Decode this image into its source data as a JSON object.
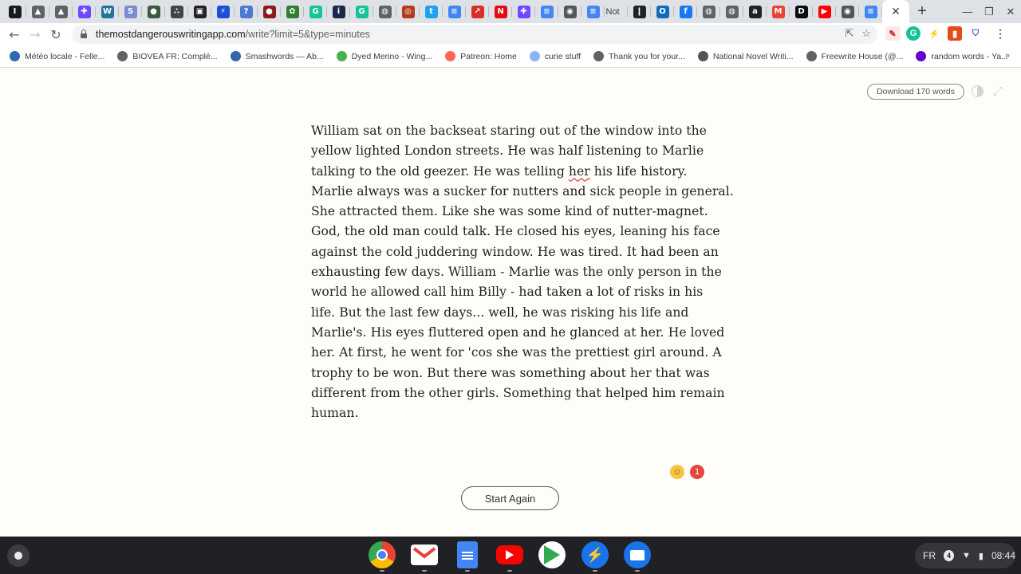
{
  "tabs": {
    "favicons": [
      {
        "name": "instapaper-icon",
        "glyph": "I",
        "bg": "#1a1a1a"
      },
      {
        "name": "mountain-icon",
        "glyph": "▲",
        "bg": "#5f6368"
      },
      {
        "name": "mountain-icon-2",
        "glyph": "▲",
        "bg": "#5f6368"
      },
      {
        "name": "slack-icon",
        "glyph": "✚",
        "bg": "#6d4aff"
      },
      {
        "name": "wordpress-icon",
        "glyph": "W",
        "bg": "#21759b"
      },
      {
        "name": "scrivener-icon",
        "glyph": "S",
        "bg": "#7b8bd4"
      },
      {
        "name": "wheel-icon",
        "glyph": "●",
        "bg": "#3a5a40"
      },
      {
        "name": "dots-icon",
        "glyph": "∴",
        "bg": "#444"
      },
      {
        "name": "tv-icon",
        "glyph": "▣",
        "bg": "#222"
      },
      {
        "name": "bolt-icon",
        "glyph": "⚡",
        "bg": "#1d4ed8"
      },
      {
        "name": "help-icon",
        "glyph": "?",
        "bg": "#4a7bd0"
      },
      {
        "name": "circle-icon",
        "glyph": "●",
        "bg": "#8b1a1a"
      },
      {
        "name": "leaf-icon",
        "glyph": "✿",
        "bg": "#2e7d32"
      },
      {
        "name": "grammarly-icon",
        "glyph": "G",
        "bg": "#15c39a"
      },
      {
        "name": "info-icon",
        "glyph": "i",
        "bg": "#1a2a4a"
      },
      {
        "name": "grammarly-icon-2",
        "glyph": "G",
        "bg": "#15c39a"
      },
      {
        "name": "globe-icon",
        "glyph": "◍",
        "bg": "#5f6368"
      },
      {
        "name": "target-icon",
        "glyph": "◎",
        "bg": "#b23b1f"
      },
      {
        "name": "twitter-icon",
        "glyph": "t",
        "bg": "#1da1f2"
      },
      {
        "name": "docs-icon",
        "glyph": "≡",
        "bg": "#4285f4"
      },
      {
        "name": "chart-icon",
        "glyph": "↗",
        "bg": "#d93025"
      },
      {
        "name": "netflix-icon",
        "glyph": "N",
        "bg": "#e50914"
      },
      {
        "name": "slack-icon-2",
        "glyph": "✚",
        "bg": "#6d4aff"
      },
      {
        "name": "docs-icon-2",
        "glyph": "≡",
        "bg": "#4285f4"
      },
      {
        "name": "owl-icon",
        "glyph": "◉",
        "bg": "#555"
      },
      {
        "name": "docs-icon-3",
        "glyph": "≡",
        "bg": "#4285f4"
      }
    ],
    "text_tab": "Not",
    "favicons_b": [
      {
        "name": "bookmark-icon",
        "glyph": "❙",
        "bg": "#222"
      },
      {
        "name": "outlook-icon",
        "glyph": "O",
        "bg": "#0f6cbd"
      },
      {
        "name": "facebook-icon",
        "glyph": "f",
        "bg": "#1877f2"
      },
      {
        "name": "globe-icon-2",
        "glyph": "◍",
        "bg": "#5f6368"
      },
      {
        "name": "globe-icon-3",
        "glyph": "◍",
        "bg": "#5f6368"
      },
      {
        "name": "amazon-icon",
        "glyph": "a",
        "bg": "#222"
      },
      {
        "name": "gmail-icon",
        "glyph": "M",
        "bg": "#ea4335"
      },
      {
        "name": "dailymotion-icon",
        "glyph": "D",
        "bg": "#0d0d0d"
      },
      {
        "name": "youtube-icon",
        "glyph": "▶",
        "bg": "#ff0000"
      },
      {
        "name": "owl-icon-2",
        "glyph": "◉",
        "bg": "#555"
      },
      {
        "name": "docs-icon-4",
        "glyph": "≡",
        "bg": "#4285f4"
      }
    ]
  },
  "omnibox": {
    "host": "themostdangerouswritingapp.com",
    "path": "/write?limit=5&type=minutes"
  },
  "bookmarks": [
    {
      "label": "Météo locale - Felle...",
      "icon": "weather-icon",
      "color": "#2b6cb0"
    },
    {
      "label": "BIOVEA FR: Complé...",
      "icon": "globe-icon",
      "color": "#5f6368"
    },
    {
      "label": "Smashwords — Ab...",
      "icon": "book-icon",
      "color": "#3366aa"
    },
    {
      "label": "Dyed Merino - Wing...",
      "icon": "w-icon",
      "color": "#4caf50"
    },
    {
      "label": "Patreon: Home",
      "icon": "patreon-icon",
      "color": "#f96854"
    },
    {
      "label": "curie stuff",
      "icon": "curie-icon",
      "color": "#8ab4f8"
    },
    {
      "label": "Thank you for your...",
      "icon": "globe-icon",
      "color": "#5f6368"
    },
    {
      "label": "National Novel Writi...",
      "icon": "nanowrimo-icon",
      "color": "#555"
    },
    {
      "label": "Freewrite House (@...",
      "icon": "globe-icon",
      "color": "#5f6368"
    },
    {
      "label": "random words - Ya...",
      "icon": "yahoo-icon",
      "color": "#6001d2"
    }
  ],
  "page": {
    "download_label": "Download 170 words",
    "paragraph_lines": [
      "William sat on the backseat staring out of the window into the",
      "yellow lighted London streets. He was half listening to Marlie",
      "talking to the old geezer. He was telling ",
      "Marlie always was a sucker for nutters and sick people in general.",
      "She attracted them. Like she was some kind of nutter-magnet.",
      "God, the old man could talk. He closed his eyes, leaning his face",
      "against the cold juddering window. He was tired. It had been an",
      "exhausting few days. William - Marlie was the only person in the",
      "world he allowed call him Billy - had taken a lot of risks in his",
      "life. But the last few days... well, he was risking his life and",
      "Marlie's. His eyes fluttered open and he glanced at her. He loved",
      "her. At first, he went for 'cos she was the prettiest girl around. A",
      "trophy to be won. But there was something about her that was",
      "different from the other girls. Something that helped him remain",
      "human."
    ],
    "line3_flagged": "her",
    "line3_rest": " his life history.",
    "reaction_count": "1",
    "start_again_label": "Start Again"
  },
  "shelf": {
    "apps": [
      "chrome-icon",
      "gmail-icon",
      "docs-icon",
      "youtube-icon",
      "play-store-icon",
      "freewrite-icon",
      "files-icon"
    ],
    "lang": "FR",
    "notifications": "4",
    "time": "08:44"
  }
}
